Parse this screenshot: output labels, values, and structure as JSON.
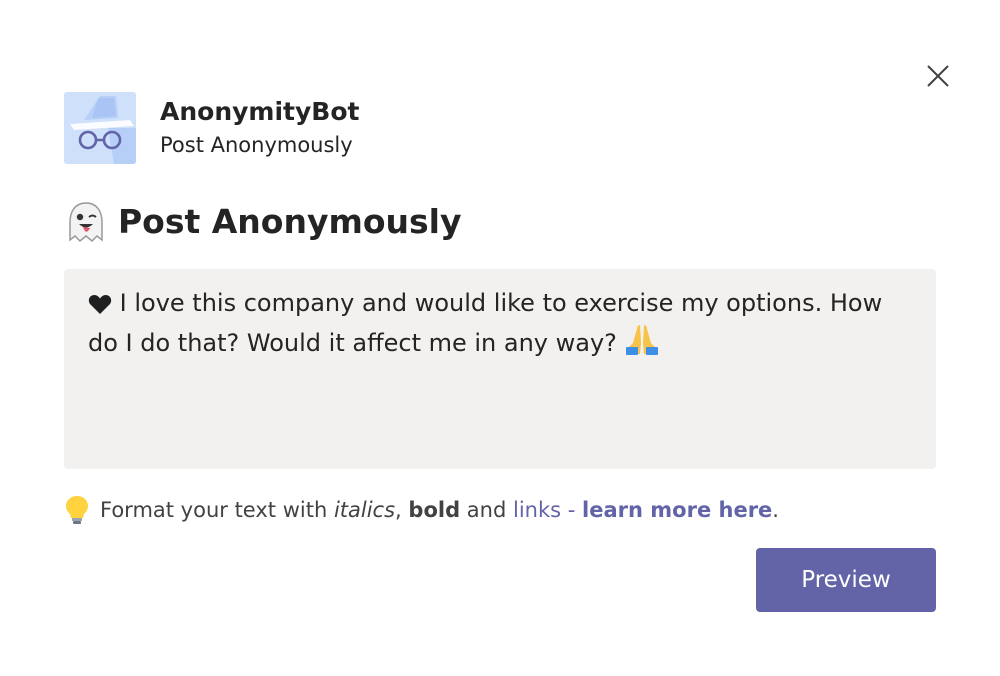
{
  "dialog": {
    "close_icon": "close-icon"
  },
  "app": {
    "name": "AnonymityBot",
    "subtitle": "Post Anonymously",
    "icon": "anonymity-bot-logo"
  },
  "card": {
    "title_emoji_icon": "ghost-icon",
    "title": "Post Anonymously",
    "message": {
      "heart_icon": "heart-icon",
      "text": "I love this company and would like to exercise my options. How do I do that? Would it affect me in any way?",
      "pray_icon": "folded-hands-icon"
    },
    "hint": {
      "bulb_icon": "lightbulb-icon",
      "prefix": "Format your text with",
      "italics": "italics",
      "comma": ",",
      "bold": "bold",
      "and": "and",
      "links": "links",
      "dash": "-",
      "learn_more": "learn more here",
      "period": "."
    },
    "preview_label": "Preview"
  },
  "colors": {
    "accent": "#6264a7",
    "textarea_bg": "#f2f1f0",
    "text": "#242424"
  }
}
